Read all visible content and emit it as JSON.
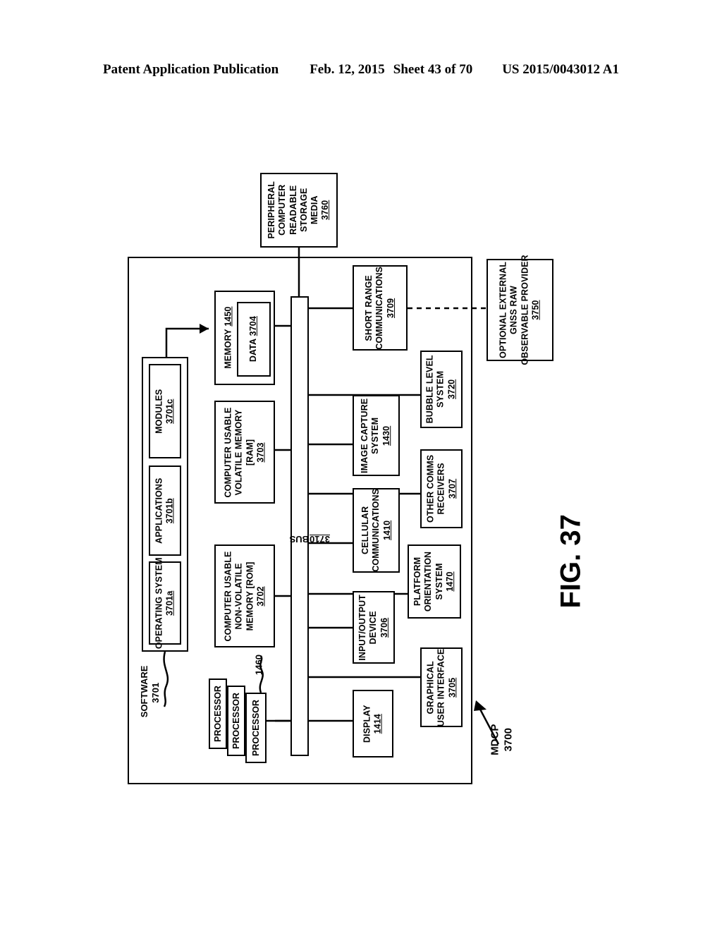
{
  "header": {
    "publication": "Patent Application Publication",
    "date": "Feb. 12, 2015",
    "sheet": "Sheet 43 of 70",
    "patent_number": "US 2015/0043012 A1"
  },
  "figure": {
    "caption": "FIG. 37",
    "system_label": "MDCP",
    "system_number": "3700"
  },
  "boxes": {
    "peripheral_media": {
      "lines": [
        "PERIPHERAL",
        "COMPUTER",
        "READABLE",
        "STORAGE",
        "MEDIA"
      ],
      "ref": "3760"
    },
    "external_gnss": {
      "lines": [
        "OPTIONAL EXTERNAL",
        "GNSS RAW",
        "OBSERVABLE PROVIDER"
      ],
      "ref": "3750"
    },
    "short_range": {
      "lines": [
        "SHORT RANGE",
        "COMMUNICATIONS"
      ],
      "ref": "3709"
    },
    "memory": {
      "label": "MEMORY",
      "ref": "1450",
      "inner": {
        "label": "DATA",
        "ref": "3704"
      }
    },
    "ram": {
      "lines": [
        "COMPUTER USABLE",
        "VOLATILE MEMORY",
        "[RAM]"
      ],
      "ref": "3703"
    },
    "rom": {
      "lines": [
        "COMPUTER USABLE",
        "NON-VOLATILE",
        "MEMORY [ROM]"
      ],
      "ref": "3702"
    },
    "bubble_level": {
      "lines": [
        "BUBBLE LEVEL",
        "SYSTEM"
      ],
      "ref": "3720"
    },
    "image_capture": {
      "lines": [
        "IMAGE CAPTURE",
        "SYSTEM"
      ],
      "ref": "1430"
    },
    "other_comms": {
      "lines": [
        "OTHER COMMS",
        "RECEIVERS"
      ],
      "ref": "3707"
    },
    "cellular": {
      "lines": [
        "CELLULAR",
        "COMMUNICATIONS"
      ],
      "ref": "1410"
    },
    "platform_orientation": {
      "lines": [
        "PLATFORM",
        "ORIENTATION",
        "SYSTEM"
      ],
      "ref": "1470"
    },
    "io_device": {
      "lines": [
        "INPUT/OUTPUT",
        "DEVICE"
      ],
      "ref": "3706"
    },
    "gui": {
      "lines": [
        "GRAPHICAL",
        "USER INTERFACE"
      ],
      "ref": "3705"
    },
    "display": {
      "lines": [
        "DISPLAY"
      ],
      "ref": "1414"
    },
    "operating_system": {
      "lines": [
        "OPERATING SYSTEM"
      ],
      "ref": "3701a"
    },
    "applications": {
      "lines": [
        "APPLICATIONS"
      ],
      "ref": "3701b"
    },
    "modules": {
      "lines": [
        "MODULES"
      ],
      "ref": "3701c"
    }
  },
  "labels": {
    "software": "SOFTWARE",
    "software_ref": "3701",
    "bus": "BUS",
    "bus_ref": "3710",
    "processor": "PROCESSOR",
    "processor_ref": "1460"
  }
}
